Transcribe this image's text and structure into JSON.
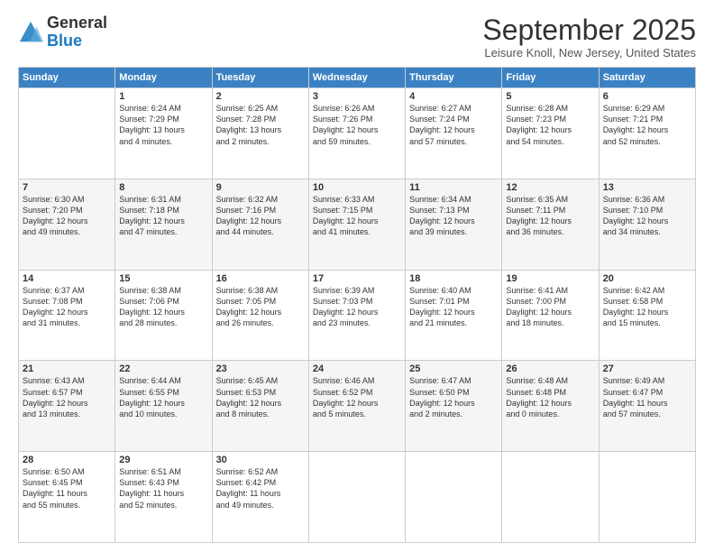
{
  "logo": {
    "general": "General",
    "blue": "Blue"
  },
  "title": "September 2025",
  "location": "Leisure Knoll, New Jersey, United States",
  "days_of_week": [
    "Sunday",
    "Monday",
    "Tuesday",
    "Wednesday",
    "Thursday",
    "Friday",
    "Saturday"
  ],
  "weeks": [
    [
      {
        "day": "",
        "info": ""
      },
      {
        "day": "1",
        "info": "Sunrise: 6:24 AM\nSunset: 7:29 PM\nDaylight: 13 hours\nand 4 minutes."
      },
      {
        "day": "2",
        "info": "Sunrise: 6:25 AM\nSunset: 7:28 PM\nDaylight: 13 hours\nand 2 minutes."
      },
      {
        "day": "3",
        "info": "Sunrise: 6:26 AM\nSunset: 7:26 PM\nDaylight: 12 hours\nand 59 minutes."
      },
      {
        "day": "4",
        "info": "Sunrise: 6:27 AM\nSunset: 7:24 PM\nDaylight: 12 hours\nand 57 minutes."
      },
      {
        "day": "5",
        "info": "Sunrise: 6:28 AM\nSunset: 7:23 PM\nDaylight: 12 hours\nand 54 minutes."
      },
      {
        "day": "6",
        "info": "Sunrise: 6:29 AM\nSunset: 7:21 PM\nDaylight: 12 hours\nand 52 minutes."
      }
    ],
    [
      {
        "day": "7",
        "info": "Sunrise: 6:30 AM\nSunset: 7:20 PM\nDaylight: 12 hours\nand 49 minutes."
      },
      {
        "day": "8",
        "info": "Sunrise: 6:31 AM\nSunset: 7:18 PM\nDaylight: 12 hours\nand 47 minutes."
      },
      {
        "day": "9",
        "info": "Sunrise: 6:32 AM\nSunset: 7:16 PM\nDaylight: 12 hours\nand 44 minutes."
      },
      {
        "day": "10",
        "info": "Sunrise: 6:33 AM\nSunset: 7:15 PM\nDaylight: 12 hours\nand 41 minutes."
      },
      {
        "day": "11",
        "info": "Sunrise: 6:34 AM\nSunset: 7:13 PM\nDaylight: 12 hours\nand 39 minutes."
      },
      {
        "day": "12",
        "info": "Sunrise: 6:35 AM\nSunset: 7:11 PM\nDaylight: 12 hours\nand 36 minutes."
      },
      {
        "day": "13",
        "info": "Sunrise: 6:36 AM\nSunset: 7:10 PM\nDaylight: 12 hours\nand 34 minutes."
      }
    ],
    [
      {
        "day": "14",
        "info": "Sunrise: 6:37 AM\nSunset: 7:08 PM\nDaylight: 12 hours\nand 31 minutes."
      },
      {
        "day": "15",
        "info": "Sunrise: 6:38 AM\nSunset: 7:06 PM\nDaylight: 12 hours\nand 28 minutes."
      },
      {
        "day": "16",
        "info": "Sunrise: 6:38 AM\nSunset: 7:05 PM\nDaylight: 12 hours\nand 26 minutes."
      },
      {
        "day": "17",
        "info": "Sunrise: 6:39 AM\nSunset: 7:03 PM\nDaylight: 12 hours\nand 23 minutes."
      },
      {
        "day": "18",
        "info": "Sunrise: 6:40 AM\nSunset: 7:01 PM\nDaylight: 12 hours\nand 21 minutes."
      },
      {
        "day": "19",
        "info": "Sunrise: 6:41 AM\nSunset: 7:00 PM\nDaylight: 12 hours\nand 18 minutes."
      },
      {
        "day": "20",
        "info": "Sunrise: 6:42 AM\nSunset: 6:58 PM\nDaylight: 12 hours\nand 15 minutes."
      }
    ],
    [
      {
        "day": "21",
        "info": "Sunrise: 6:43 AM\nSunset: 6:57 PM\nDaylight: 12 hours\nand 13 minutes."
      },
      {
        "day": "22",
        "info": "Sunrise: 6:44 AM\nSunset: 6:55 PM\nDaylight: 12 hours\nand 10 minutes."
      },
      {
        "day": "23",
        "info": "Sunrise: 6:45 AM\nSunset: 6:53 PM\nDaylight: 12 hours\nand 8 minutes."
      },
      {
        "day": "24",
        "info": "Sunrise: 6:46 AM\nSunset: 6:52 PM\nDaylight: 12 hours\nand 5 minutes."
      },
      {
        "day": "25",
        "info": "Sunrise: 6:47 AM\nSunset: 6:50 PM\nDaylight: 12 hours\nand 2 minutes."
      },
      {
        "day": "26",
        "info": "Sunrise: 6:48 AM\nSunset: 6:48 PM\nDaylight: 12 hours\nand 0 minutes."
      },
      {
        "day": "27",
        "info": "Sunrise: 6:49 AM\nSunset: 6:47 PM\nDaylight: 11 hours\nand 57 minutes."
      }
    ],
    [
      {
        "day": "28",
        "info": "Sunrise: 6:50 AM\nSunset: 6:45 PM\nDaylight: 11 hours\nand 55 minutes."
      },
      {
        "day": "29",
        "info": "Sunrise: 6:51 AM\nSunset: 6:43 PM\nDaylight: 11 hours\nand 52 minutes."
      },
      {
        "day": "30",
        "info": "Sunrise: 6:52 AM\nSunset: 6:42 PM\nDaylight: 11 hours\nand 49 minutes."
      },
      {
        "day": "",
        "info": ""
      },
      {
        "day": "",
        "info": ""
      },
      {
        "day": "",
        "info": ""
      },
      {
        "day": "",
        "info": ""
      }
    ]
  ]
}
